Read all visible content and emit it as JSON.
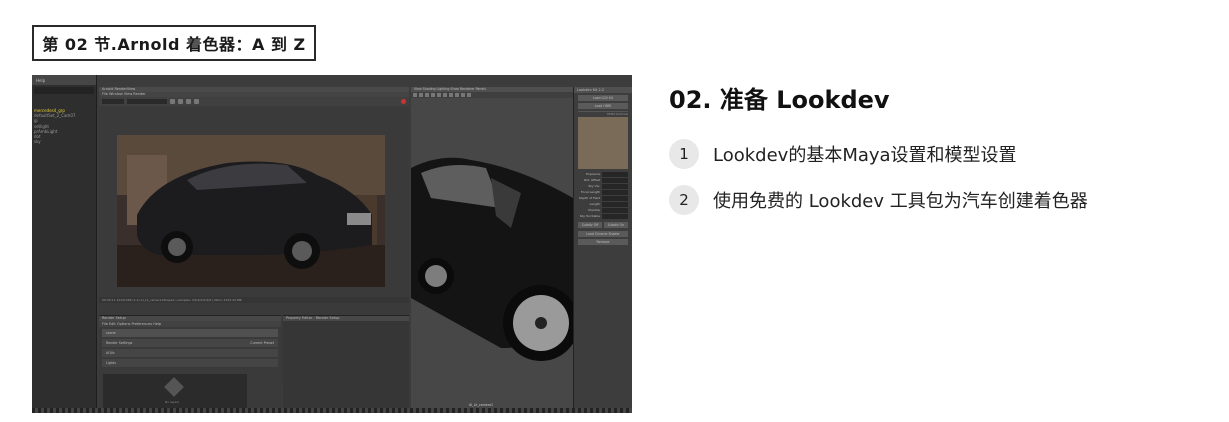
{
  "section_tag": "第 02 节.Arnold 着色器：A 到 Z",
  "heading": "02. 准备 Lookdev",
  "steps": [
    {
      "num": "1",
      "text": "Lookdev的基本Maya设置和模型设置"
    },
    {
      "num": "2",
      "text": "使用免费的 Lookdev 工具包为汽车创建着色器"
    }
  ],
  "maya": {
    "outliner_menu": "Help",
    "outliner_items": [
      "mercedes4_grp",
      "defaultSet_2_Cam07",
      "gi",
      "setlight",
      "prAmbLight",
      "dot",
      "sky"
    ],
    "render_view_title": "Arnold RenderView",
    "render_view_menu": "File   Window   View   Render",
    "render_view_dropdown_1": "Beauty",
    "render_view_dropdown_2": "AI_Lk_camera1Shape1",
    "render_view_zoom": "1:1",
    "render_view_status": "00:00:11  1024x568 (1:1)  AI_Lk_camera1Shape1  | samples: 3/2/2/2/2/2/0  |  Mem: 2154.44 MB",
    "render_setup_title": "Render Setup",
    "render_setup_menu": "File   Edit   Options   Preferences   Help",
    "render_setup_rows": [
      "scene",
      "Render Settings",
      "AOVs",
      "Lights"
    ],
    "render_setup_current": "Current Preset",
    "render_setup_lib": "No layers",
    "property_editor_title": "Property Editor - Render Setup",
    "viewport_menu": "View   Shading   Lighting   Show   Renderer   Panels",
    "viewport_camera": "AI_Lk_camera1",
    "lookdev_title": "Lookdev Kit 2.2",
    "lookdev_buttons": [
      "Load LDV Kit",
      "Load HDRI"
    ],
    "lookdev_section": "HDRI Controls",
    "lookdev_fields": [
      "Exposure",
      "Rot. Offset",
      "Sky Vis.",
      "Focal Length",
      "Depth of Field",
      "Length",
      "Shadow",
      "Sky Turntable"
    ],
    "lookdev_bottom_buttons": [
      "Subdiv Off",
      "Subdiv On",
      "Load Chrome Shader",
      "Remove"
    ]
  }
}
